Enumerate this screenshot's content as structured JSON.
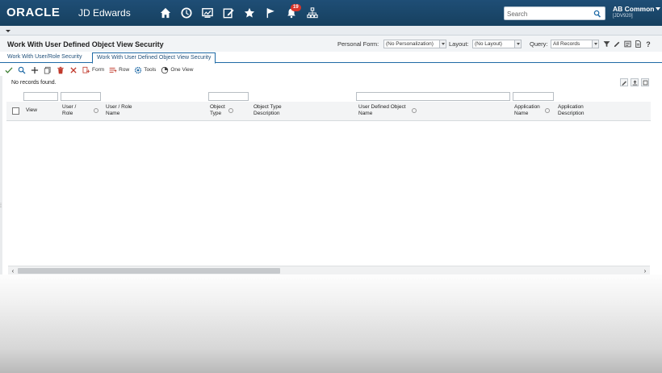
{
  "header": {
    "brand": "ORACLE",
    "product": "JD Edwards",
    "icons": [
      "home-icon",
      "recent-icon",
      "dashboard-icon",
      "edit-icon",
      "favorites-icon",
      "flag-icon",
      "notification-icon",
      "org-chart-icon"
    ],
    "notification_count": "19",
    "search_placeholder": "Search",
    "user_name": "AB Common",
    "user_env": "[JDV920]"
  },
  "form": {
    "title": "Work With User Defined Object View Security",
    "personal_form_label": "Personal Form:",
    "personal_form_value": "(No Personalization)",
    "layout_label": "Layout:",
    "layout_value": "(No Layout)",
    "query_label": "Query:",
    "query_value": "All Records",
    "help_label": "?"
  },
  "tabs": [
    {
      "label": "Work With User/Role Security",
      "active": false
    },
    {
      "label": "Work With User Defined Object View Security",
      "active": true
    }
  ],
  "toolbar": {
    "form_label": "Form",
    "row_label": "Row",
    "tools_label": "Tools",
    "one_view_label": "One View"
  },
  "grid": {
    "message": "No records found.",
    "columns": [
      {
        "line1": "View",
        "line2": ""
      },
      {
        "line1": "User /",
        "line2": "Role"
      },
      {
        "line1": "User / Role",
        "line2": "Name"
      },
      {
        "line1": "Object",
        "line2": "Type"
      },
      {
        "line1": "Object Type",
        "line2": "Description"
      },
      {
        "line1": "User Defined Object",
        "line2": "Name"
      },
      {
        "line1": "Application",
        "line2": "Name"
      },
      {
        "line1": "Application",
        "line2": "Description"
      }
    ],
    "rows": []
  },
  "colors": {
    "header_bg": "#1f4e76",
    "tab_accent": "#1f6aa6",
    "badge": "#d9352b"
  }
}
